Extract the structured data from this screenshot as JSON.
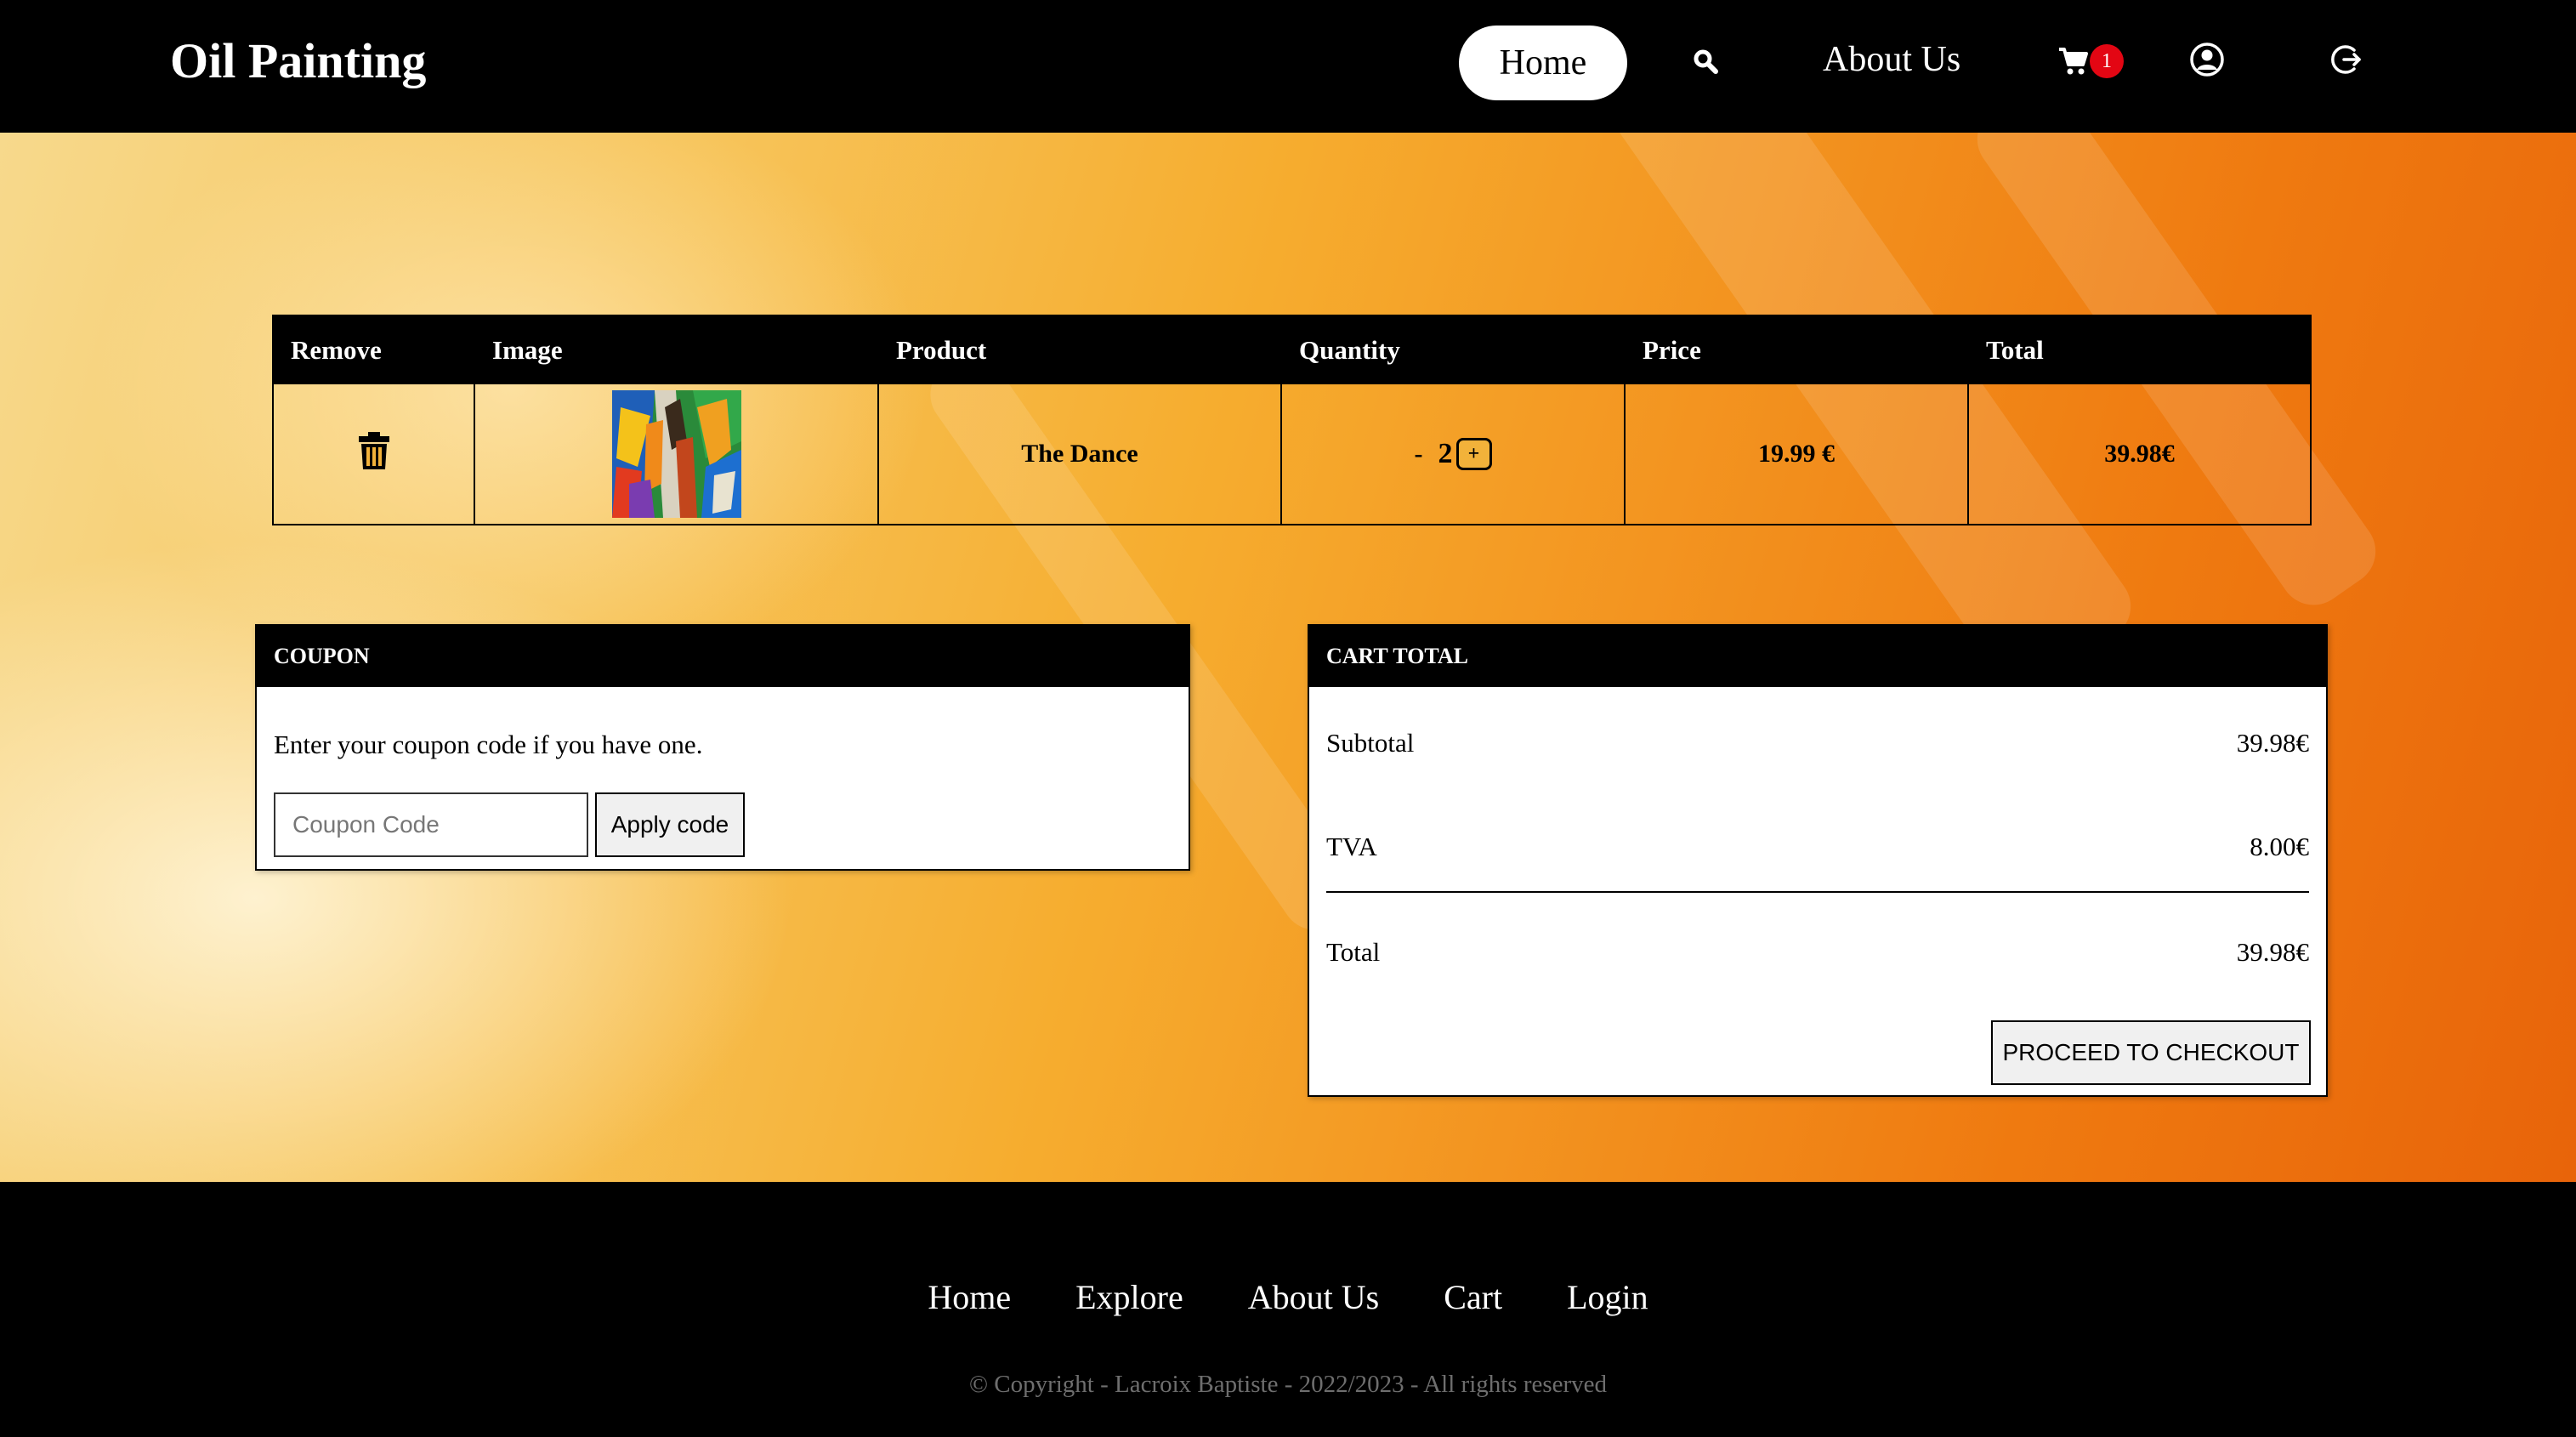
{
  "header": {
    "brand": "Oil Painting",
    "nav": {
      "home": "Home",
      "about": "About Us",
      "cart_badge": "1"
    },
    "icons": [
      "search-icon",
      "cart-icon",
      "user-icon",
      "logout-icon"
    ]
  },
  "cart": {
    "columns": [
      "Remove",
      "Image",
      "Product",
      "Quantity",
      "Price",
      "Total"
    ],
    "items": [
      {
        "product": "The Dance",
        "quantity_minus": "-",
        "quantity": "2",
        "quantity_plus": "+",
        "price": "19.99 €",
        "total": "39.98€"
      }
    ]
  },
  "coupon": {
    "title": "COUPON",
    "text": "Enter your coupon code if you have one.",
    "placeholder": "Coupon Code",
    "apply_label": "Apply code"
  },
  "cart_total": {
    "title": "CART TOTAL",
    "subtotal_label": "Subtotal",
    "subtotal_value": "39.98€",
    "tva_label": "TVA",
    "tva_value": "8.00€",
    "total_label": "Total",
    "total_value": "39.98€",
    "checkout_label": "PROCEED TO CHECKOUT"
  },
  "footer": {
    "links": [
      "Home",
      "Explore",
      "About Us",
      "Cart",
      "Login"
    ],
    "copyright": "© Copyright - Lacroix Baptiste - 2022/2023 - All rights reserved"
  },
  "colors": {
    "header_bg": "#000000",
    "badge": "#e30613",
    "accent_orange": "#f39420"
  }
}
